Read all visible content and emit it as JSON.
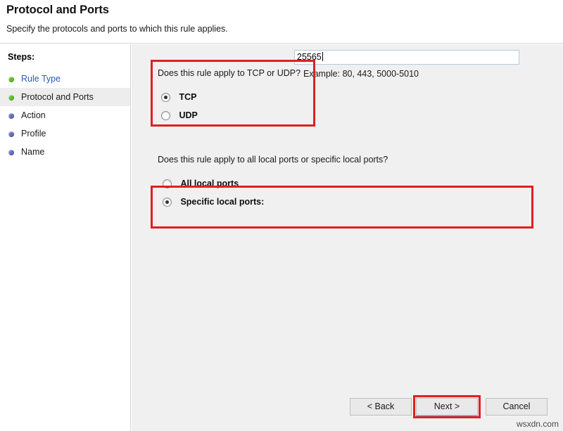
{
  "header": {
    "title": "Protocol and Ports",
    "subtitle": "Specify the protocols and ports to which this rule applies."
  },
  "sidebar": {
    "steps_label": "Steps:",
    "items": [
      {
        "label": "Rule Type",
        "bullet": "green-bullet-icon",
        "state": "completed-link"
      },
      {
        "label": "Protocol and Ports",
        "bullet": "green-bullet-icon",
        "state": "current"
      },
      {
        "label": "Action",
        "bullet": "blue-bullet-icon",
        "state": "pending"
      },
      {
        "label": "Profile",
        "bullet": "blue-bullet-icon",
        "state": "pending"
      },
      {
        "label": "Name",
        "bullet": "blue-bullet-icon",
        "state": "pending"
      }
    ]
  },
  "main": {
    "protocol": {
      "question": "Does this rule apply to TCP or UDP?",
      "options": [
        {
          "label": "TCP",
          "selected": true
        },
        {
          "label": "UDP",
          "selected": false
        }
      ]
    },
    "ports": {
      "question": "Does this rule apply to all local ports or specific local ports?",
      "options": [
        {
          "label": "All local ports",
          "selected": false
        },
        {
          "label": "Specific local ports:",
          "selected": true
        }
      ],
      "input_value": "25565",
      "input_placeholder": "",
      "example_hint": "Example: 80, 443, 5000-5010"
    }
  },
  "footer": {
    "back_label": "< Back",
    "next_label": "Next >",
    "cancel_label": "Cancel"
  },
  "watermark": "wsxdn.com",
  "colors": {
    "annotation": "#e02020",
    "link": "#2a5db0",
    "bullet_done": "#5fc02c",
    "bullet_pending": "#6c6fc4",
    "panel": "#f0f0f0"
  }
}
